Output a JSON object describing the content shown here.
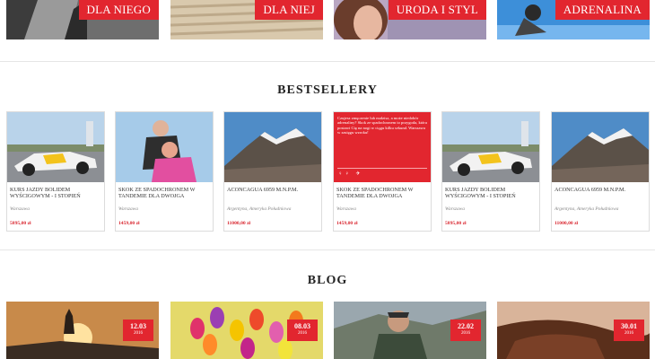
{
  "categories": [
    {
      "label": "DLA NIEGO"
    },
    {
      "label": "DLA NIEJ"
    },
    {
      "label": "URODA I STYL"
    },
    {
      "label": "ADRENALINA"
    }
  ],
  "bestsellers": {
    "title": "BESTSELLERY",
    "products": [
      {
        "name": "KURS JAZDY BOLIDEM WYŚCIGOWYM - I STOPIEŃ",
        "location": "Warszawa",
        "price": "5895,00 zł",
        "image": "race-car-photo"
      },
      {
        "name": "SKOK ZE SPADOCHRONEM W TANDEMIE DLA DWOJGA",
        "location": "Warszawa",
        "price": "1459,00 zł",
        "image": "tandem-skydive-photo",
        "promo": {
          "text": "Czujesz zmęczenie lub nudzisz, a może niedobór adrenaliny? Skok ze spadochronem to przygoda, która postawi Cię na nogi w ciągu kilku sekund. Warszawa w zasięgu wzroku!",
          "icons": "couple-icon plane-icon"
        }
      },
      {
        "name": "ACONCAGUA 6959 M.N.P.M.",
        "location": "Argentyna, Ameryka Południowa",
        "price": "11000,00 zł",
        "image": "mountain-photo"
      },
      {
        "name": "SKOK ZE SPADOCHRONEM W TANDEMIE DLA DWOJGA",
        "location": "Warszawa",
        "price": "1459,00 zł",
        "image": "promo-red",
        "promo": {
          "text": "Czujesz zmęczenie lub nudzisz, a może niedobór adrenaliny? Skok ze spadochronem to przygoda, która postawi Cię na nogi w ciągu kilku sekund. Warszawa w zasięgu wzroku!"
        }
      },
      {
        "name": "KURS JAZDY BOLIDEM WYŚCIGOWYM - I STOPIEŃ",
        "location": "Warszawa",
        "price": "5895,00 zł",
        "image": "race-car-photo"
      },
      {
        "name": "ACONCAGUA 6959 M.N.P.M.",
        "location": "Argentyna, Ameryka Południowa",
        "price": "11000,00 zł",
        "image": "mountain-photo"
      }
    ]
  },
  "blog": {
    "title": "BLOG",
    "posts": [
      {
        "day": "12.03",
        "year": "2016",
        "image": "sunrise-hiker-photo"
      },
      {
        "day": "08.03",
        "year": "2016",
        "image": "tulips-photo"
      },
      {
        "day": "22.02",
        "year": "2016",
        "image": "mountain-hiker-photo"
      },
      {
        "day": "30.01",
        "year": "2016",
        "image": "chocolate-spa-photo"
      }
    ]
  },
  "colors": {
    "accent": "#e2262f"
  }
}
